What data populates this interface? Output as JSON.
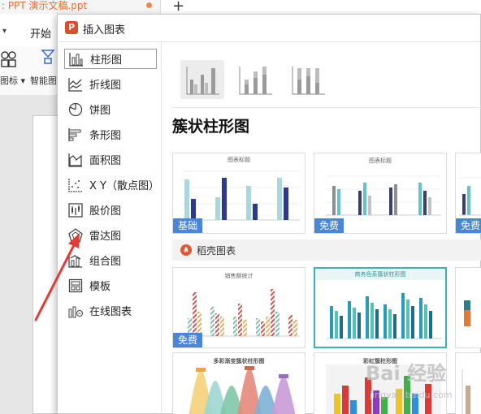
{
  "app": {
    "tab_title": ": PPT 演示文稿.ppt",
    "new_tab": "+",
    "menu_chevron": "▾",
    "menu_start": "开始",
    "ribbon_label_1": "图标 ▾",
    "ribbon_label_2": "智能图"
  },
  "dialog": {
    "title": "插入图表",
    "logo": "P",
    "nav": [
      {
        "label": "柱形图",
        "icon": "bar-chart-icon",
        "active": true
      },
      {
        "label": "折线图",
        "icon": "line-chart-icon"
      },
      {
        "label": "饼图",
        "icon": "pie-chart-icon"
      },
      {
        "label": "条形图",
        "icon": "horizontal-bar-icon"
      },
      {
        "label": "面积图",
        "icon": "area-chart-icon"
      },
      {
        "label": "X Y（散点图）",
        "icon": "scatter-chart-icon"
      },
      {
        "label": "股价图",
        "icon": "stock-chart-icon"
      },
      {
        "label": "雷达图",
        "icon": "radar-chart-icon"
      },
      {
        "label": "组合图",
        "icon": "combo-chart-icon"
      },
      {
        "label": "模板",
        "icon": "template-icon"
      },
      {
        "label": "在线图表",
        "icon": "online-chart-icon"
      }
    ],
    "section_title": "簇状柱形图",
    "banner_text": "稻壳图表",
    "templates": [
      {
        "badge": "基础",
        "title": "图表标题"
      },
      {
        "badge": "免费",
        "title": "图表标题"
      },
      {
        "badge": "免费",
        "title": ""
      },
      {
        "badge": "免费",
        "title": "销售额统计"
      },
      {
        "badge": "",
        "title": "商务色系簇状柱形图"
      },
      {
        "badge": "",
        "title": "多彩渐变簇状柱形图"
      },
      {
        "badge": "",
        "title": "彩虹簇柱形图"
      }
    ],
    "colors": {
      "accent": "#4a86d8",
      "teal": "#37b3b3",
      "logo": "#d94f2b",
      "arrow": "#e53935"
    }
  },
  "watermark": {
    "text": "Bai 经验",
    "sub": "jingyan.baidu.com"
  }
}
